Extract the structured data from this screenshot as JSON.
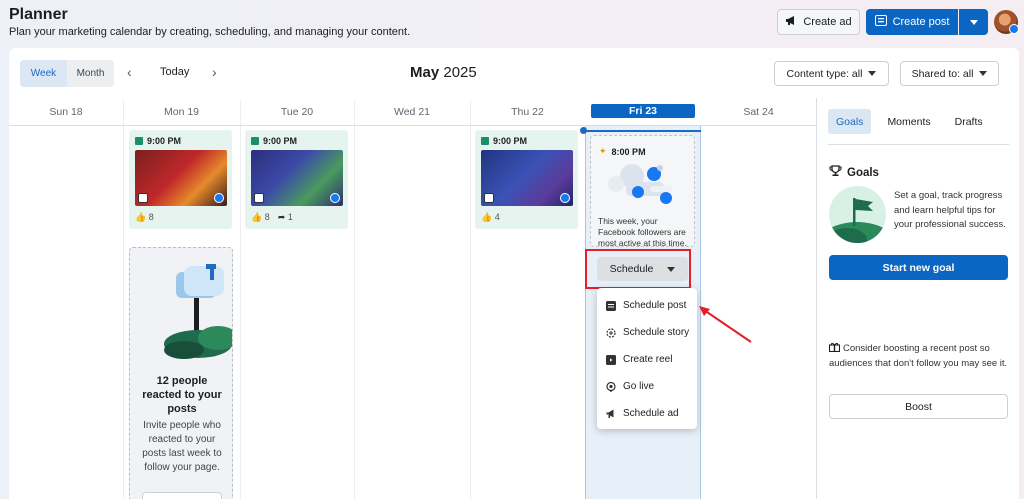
{
  "header": {
    "title": "Planner",
    "subtitle": "Plan your marketing calendar by creating, scheduling, and managing your content.",
    "create_ad": "Create ad",
    "create_post": "Create post"
  },
  "toolbar": {
    "week": "Week",
    "month": "Month",
    "today": "Today",
    "month_name": "May",
    "year": "2025",
    "content_type": "Content type: all",
    "shared_to": "Shared to: all"
  },
  "days": [
    {
      "label": "Sun 18"
    },
    {
      "label": "Mon 19"
    },
    {
      "label": "Tue 20"
    },
    {
      "label": "Wed 21"
    },
    {
      "label": "Thu 22"
    },
    {
      "label": "Fri 23"
    },
    {
      "label": "Sat 24"
    }
  ],
  "posts": [
    {
      "time": "9:00 PM",
      "likes": "8",
      "shares": ""
    },
    {
      "time": "9:00 PM",
      "likes": "8",
      "shares": "1"
    },
    {
      "time": "9:00 PM",
      "likes": "4",
      "shares": ""
    }
  ],
  "reach_card": {
    "title": "12 people reacted to your posts",
    "text": "Invite people who reacted to your posts last week to follow your page."
  },
  "suggestion": {
    "time": "8:00 PM",
    "text": "This week, your Facebook followers are most active at this time."
  },
  "schedule_button": "Schedule",
  "schedule_menu": [
    {
      "label": "Schedule post",
      "icon": "post-icon"
    },
    {
      "label": "Schedule story",
      "icon": "story-icon"
    },
    {
      "label": "Create reel",
      "icon": "reel-icon"
    },
    {
      "label": "Go live",
      "icon": "live-icon"
    },
    {
      "label": "Schedule ad",
      "icon": "megaphone-icon"
    }
  ],
  "sidebar": {
    "tabs": [
      "Goals",
      "Moments",
      "Drafts"
    ],
    "goals_heading": "Goals",
    "goals_text": "Set a goal, track progress and learn helpful tips for your professional success.",
    "start_goal": "Start new goal",
    "boost_text": "Consider boosting a recent post so audiences that don't follow you may see it.",
    "boost": "Boost"
  },
  "colors": {
    "accent": "#0a66c2",
    "highlight_box": "#e22027",
    "post_card_bg": "#e6f4ef"
  }
}
